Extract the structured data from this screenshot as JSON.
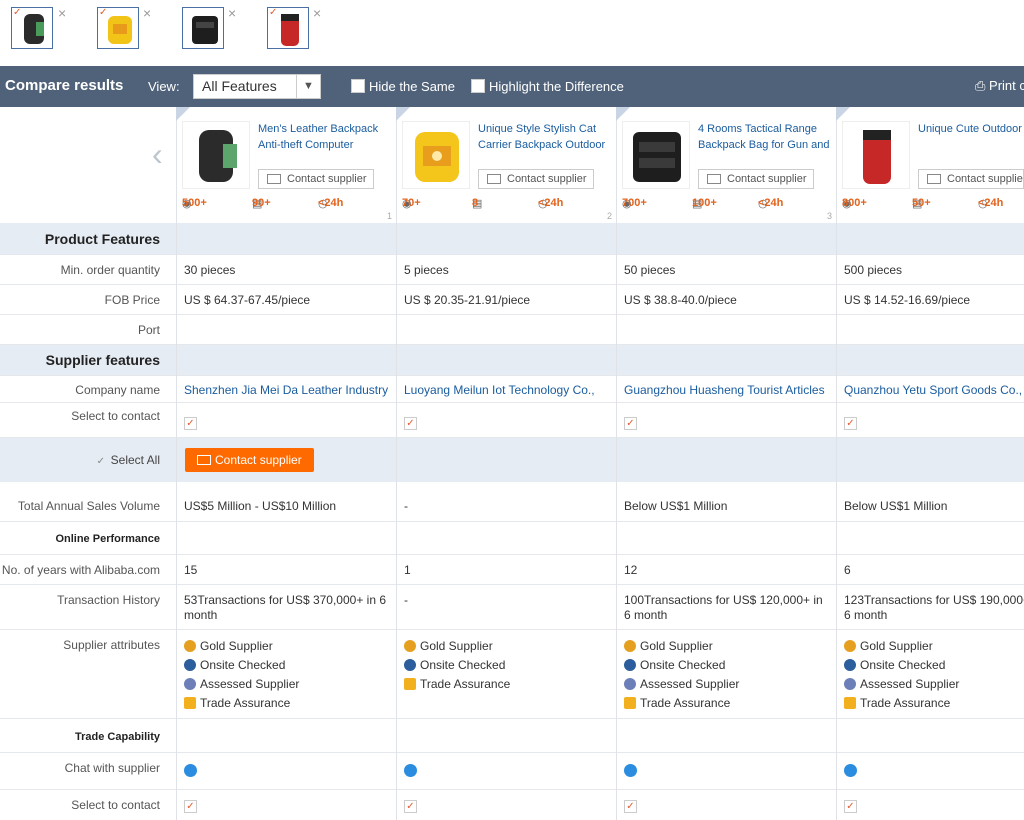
{
  "compare_bar": {
    "items": [
      {
        "id": 1
      },
      {
        "id": 2
      },
      {
        "id": 3
      },
      {
        "id": 4
      }
    ],
    "remove_glyph": "×",
    "check_glyph": "✓"
  },
  "toolbar": {
    "title": "Compare results",
    "view_label": "View:",
    "view_selected": "All Features",
    "hide_same": "Hide the Same",
    "highlight_diff": "Highlight the Difference",
    "print": "Print c"
  },
  "products": [
    {
      "title": "Men's Leather Backpack Anti-theft Computer",
      "contact": "Contact supplier",
      "views": "500+",
      "inquiries": "90+",
      "response": "<24h",
      "num": "1"
    },
    {
      "title": "Unique Style Stylish Cat Carrier Backpack Outdoor",
      "contact": "Contact supplier",
      "views": "70+",
      "inquiries": "8",
      "response": "<24h",
      "num": "2"
    },
    {
      "title": "4 Rooms Tactical Range Backpack Bag for Gun and",
      "contact": "Contact supplier",
      "views": "700+",
      "inquiries": "100+",
      "response": "<24h",
      "num": "3"
    },
    {
      "title": "Unique Cute Outdoor Adventure Floating Raft",
      "contact": "Contact supplier",
      "views": "800+",
      "inquiries": "50+",
      "response": "<24h",
      "num": ""
    }
  ],
  "sections": {
    "product_features": "Product Features",
    "supplier_features": "Supplier features",
    "online_performance": "Online Performance",
    "trade_capability": "Trade Capability"
  },
  "labels": {
    "moq": "Min. order quantity",
    "fob": "FOB Price",
    "port": "Port",
    "company": "Company name",
    "select_contact": "Select to contact",
    "select_all": "Select All",
    "contact_btn": "Contact supplier",
    "annual_sales": "Total Annual Sales Volume",
    "years": "No. of years with Alibaba.com",
    "transactions": "Transaction History",
    "attributes": "Supplier attributes",
    "chat": "Chat with supplier",
    "select_contact2": "Select to contact"
  },
  "moq": [
    "30 pieces",
    "5 pieces",
    "50 pieces",
    "500 pieces"
  ],
  "fob": [
    "US $ 64.37-67.45/piece",
    "US $ 20.35-21.91/piece",
    "US $ 38.8-40.0/piece",
    "US $ 14.52-16.69/piece"
  ],
  "company": [
    "Shenzhen Jia Mei Da Leather Industry",
    "Luoyang Meilun Iot Technology Co.,",
    "Guangzhou Huasheng Tourist Articles",
    "Quanzhou Yetu Sport Goods Co., L"
  ],
  "annual_sales": [
    "US$5 Million - US$10 Million",
    "-",
    "Below US$1 Million",
    "Below US$1 Million"
  ],
  "years": [
    "15",
    "1",
    "12",
    "6"
  ],
  "transactions": [
    [
      "53Transactions for US$ 370,000+ in 6",
      "month"
    ],
    [
      "-",
      ""
    ],
    [
      "100Transactions for US$ 120,000+ in",
      "6 month"
    ],
    [
      "123Transactions for US$ 190,000+",
      "6 month"
    ]
  ],
  "attributes": [
    [
      "Gold Supplier",
      "Onsite Checked",
      "Assessed Supplier",
      "Trade Assurance"
    ],
    [
      "Gold Supplier",
      "Onsite Checked",
      "Trade Assurance",
      ""
    ],
    [
      "Gold Supplier",
      "Onsite Checked",
      "Assessed Supplier",
      "Trade Assurance"
    ],
    [
      "Gold Supplier",
      "Onsite Checked",
      "Assessed Supplier",
      "Trade Assurance"
    ]
  ],
  "colors": {
    "accent": "#ff6a00",
    "toolbar": "#4f6279",
    "section": "#e6ecf3",
    "link": "#1a5c9e"
  }
}
